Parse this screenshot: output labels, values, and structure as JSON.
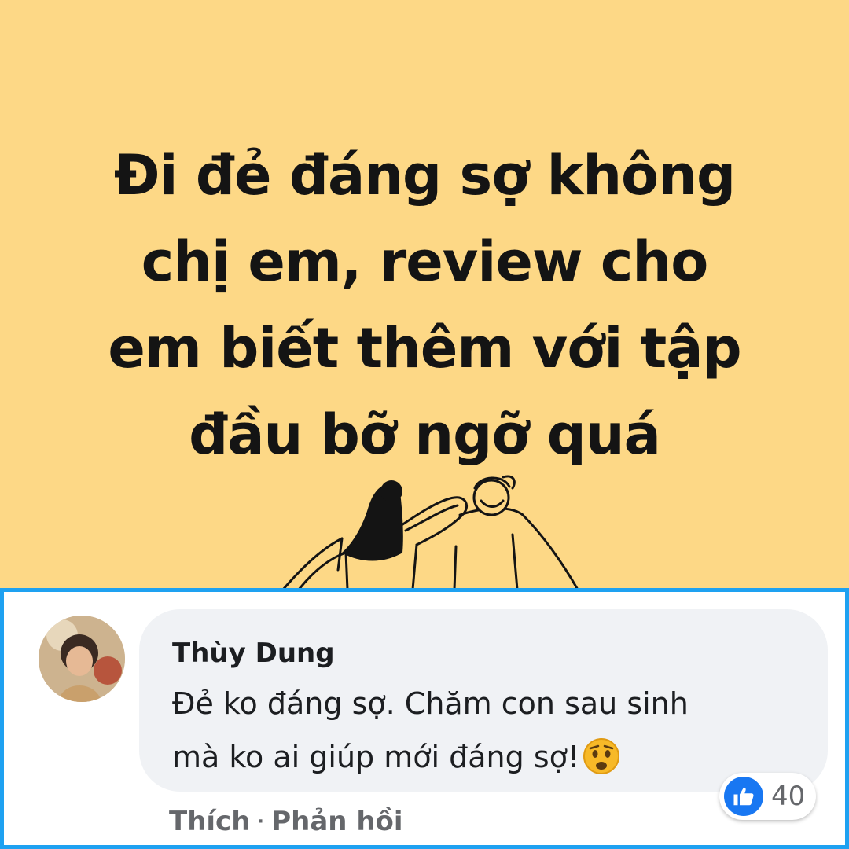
{
  "post": {
    "lines": [
      "Đi đẻ đáng sợ không",
      "chị em, review cho",
      "em biết thêm với tập",
      "đầu bỡ ngỡ quá"
    ],
    "background_color": "#fdd886"
  },
  "comment": {
    "author": "Thùy Dung",
    "text_lines": [
      "Đẻ ko đáng sợ. Chăm con sau sinh",
      "mà ko ai giúp mới đáng sợ!"
    ],
    "emoji": "sad-face-emoji",
    "reactions": {
      "icon": "like-icon",
      "count": "40"
    },
    "actions": {
      "like": "Thích",
      "separator": "·",
      "reply": "Phản hồi"
    }
  },
  "colors": {
    "highlight_border": "#1ea1f1",
    "bubble": "#f0f2f5",
    "like_blue": "#1877f2"
  }
}
